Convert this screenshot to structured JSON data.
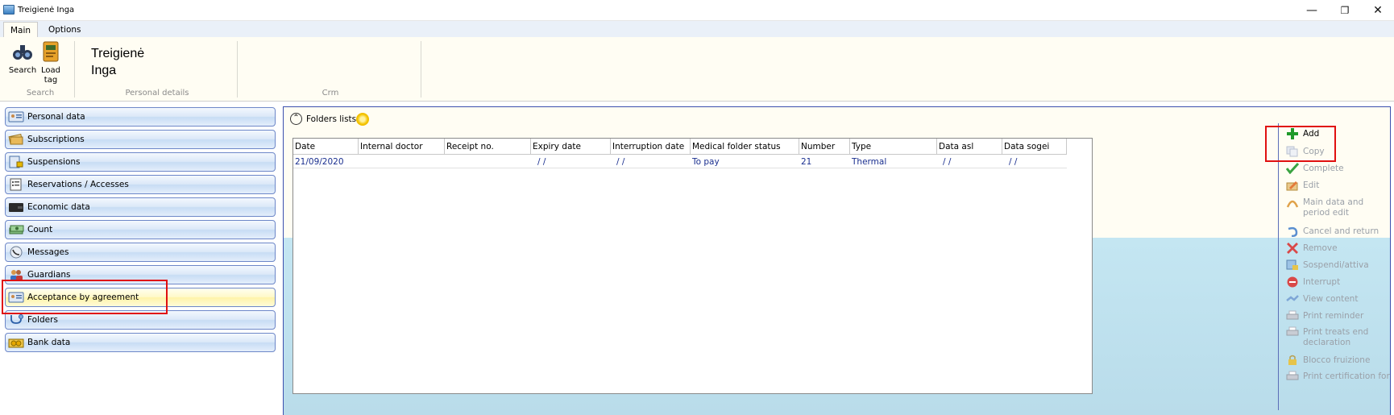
{
  "window": {
    "title": "Treigienė Inga",
    "minimize": "—",
    "restore": "❐",
    "close": "✕"
  },
  "tabs": [
    {
      "label": "Main"
    },
    {
      "label": "Options"
    }
  ],
  "ribbon": {
    "search_button": "Search",
    "load_tag_button": "Load tag",
    "search_group": "Search",
    "person_name_line1": "Treigienė",
    "person_name_line2": "Inga",
    "personal_group": "Personal details",
    "crm_group": "Crm"
  },
  "nav": [
    {
      "label": "Personal data",
      "icon": "id-card-icon"
    },
    {
      "label": "Subscriptions",
      "icon": "tickets-icon"
    },
    {
      "label": "Suspensions",
      "icon": "lock-document-icon"
    },
    {
      "label": "Reservations / Accesses",
      "icon": "checklist-icon"
    },
    {
      "label": "Economic data",
      "icon": "wallet-icon"
    },
    {
      "label": "Count",
      "icon": "money-stack-icon"
    },
    {
      "label": "Messages",
      "icon": "phone-message-icon"
    },
    {
      "label": "Guardians",
      "icon": "people-icon"
    },
    {
      "label": "Acceptance by agreement",
      "icon": "agreement-card-icon"
    },
    {
      "label": "Folders",
      "icon": "stethoscope-icon"
    },
    {
      "label": "Bank data",
      "icon": "bank-coins-icon"
    }
  ],
  "folders": {
    "title": "Folders lists",
    "collapse_glyph": "⌃",
    "columns": [
      "Date",
      "Internal doctor",
      "Receipt no.",
      "Expiry date",
      "Interruption date",
      "Medical folder status",
      "Number",
      "Type",
      "Data asl",
      "Data sogei"
    ],
    "rows": [
      [
        "21/09/2020",
        "",
        "",
        "/ /",
        "/ /",
        "To pay",
        "21",
        "Thermal",
        "/ /",
        "/ /"
      ]
    ]
  },
  "actions": [
    {
      "label": "Add",
      "enabled": true,
      "icon": "plus-icon"
    },
    {
      "label": "Copy",
      "enabled": false,
      "icon": "copy-icon"
    },
    {
      "label": "Complete",
      "enabled": false,
      "icon": "checkmark-icon"
    },
    {
      "label": "Edit",
      "enabled": false,
      "icon": "edit-icon"
    },
    {
      "label": "Main data and period edit",
      "enabled": false,
      "icon": "period-edit-icon"
    },
    {
      "label": "Cancel and return",
      "enabled": false,
      "icon": "undo-icon"
    },
    {
      "label": "Remove",
      "enabled": false,
      "icon": "remove-x-icon"
    },
    {
      "label": "Sospendi/attiva",
      "enabled": false,
      "icon": "suspend-icon"
    },
    {
      "label": "Interrupt",
      "enabled": false,
      "icon": "stop-icon"
    },
    {
      "label": "View content",
      "enabled": false,
      "icon": "view-icon"
    },
    {
      "label": "Print reminder",
      "enabled": false,
      "icon": "printer-icon"
    },
    {
      "label": "Print treats end declaration",
      "enabled": false,
      "icon": "printer-icon"
    },
    {
      "label": "Blocco fruizione",
      "enabled": false,
      "icon": "padlock-icon"
    },
    {
      "label": "Print certification for",
      "enabled": false,
      "icon": "printer-icon"
    }
  ],
  "colors": {
    "highlight": "#e01010",
    "nav_border": "#6d87c8",
    "selected_nav": "#fff3a8",
    "row_text": "#1a2f8f",
    "add_plus": "#1f9a2a"
  }
}
